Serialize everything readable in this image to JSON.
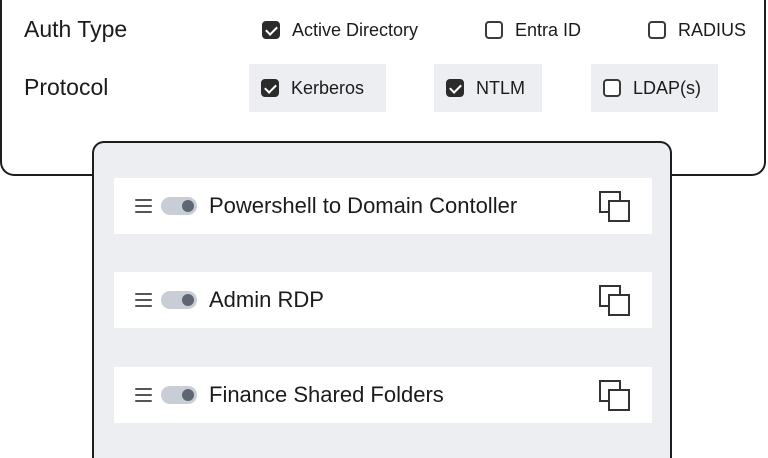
{
  "auth": {
    "label": "Auth Type",
    "options": [
      {
        "label": "Active Directory",
        "checked": true
      },
      {
        "label": "Entra ID",
        "checked": false
      },
      {
        "label": "RADIUS",
        "checked": false
      }
    ]
  },
  "protocol": {
    "label": "Protocol",
    "options": [
      {
        "label": "Kerberos",
        "checked": true
      },
      {
        "label": "NTLM",
        "checked": true
      },
      {
        "label": "LDAP(s)",
        "checked": false
      }
    ]
  },
  "rules": [
    {
      "name": "Powershell to Domain Contoller",
      "enabled": true
    },
    {
      "name": "Admin RDP",
      "enabled": true
    },
    {
      "name": "Finance Shared Folders",
      "enabled": true
    }
  ],
  "icons": {
    "drag": "drag-handle-icon",
    "copy": "copy-icon"
  },
  "colors": {
    "border": "#1d1d1d",
    "panel_bg": "#eceef1",
    "checkbox_checked": "#2b2b2b",
    "toggle_track": "#c9ced6",
    "toggle_knob": "#5f6673"
  }
}
